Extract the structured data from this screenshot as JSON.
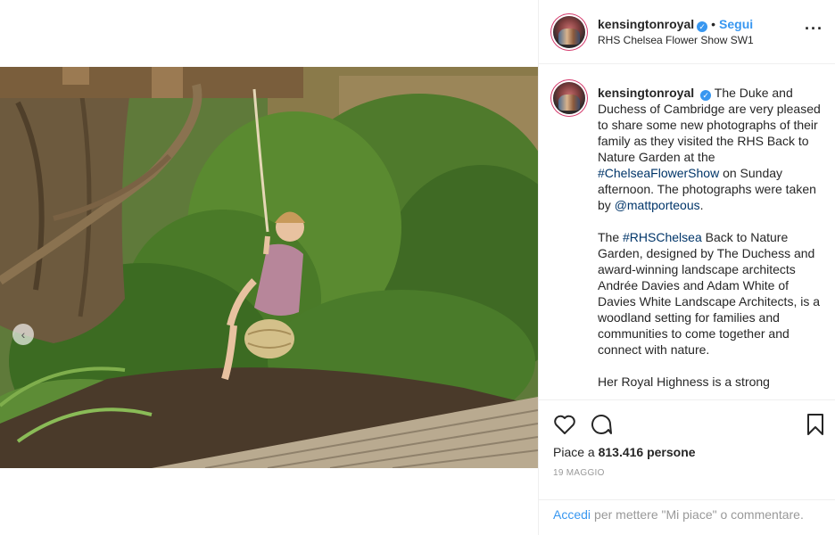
{
  "media": {
    "carousel_prev": "‹"
  },
  "header": {
    "username": "kensingtonroyal",
    "verified_mark": "✓",
    "separator": "•",
    "follow_label": "Segui",
    "location": "RHS Chelsea Flower Show SW1",
    "more_label": "···"
  },
  "caption": {
    "username": "kensingtonroyal",
    "p1_a": "The Duke and Duchess of Cambridge are very pleased to share some new photographs of their family as they visited the RHS Back to Nature Garden at the ",
    "p1_tag": "#ChelseaFlowerShow",
    "p1_b": " on Sunday afternoon. The photographs were taken by ",
    "p1_mention": "@mattporteous",
    "p1_c": ".",
    "p2_a": "The ",
    "p2_tag": "#RHSChelsea",
    "p2_b": " Back to Nature Garden, designed by The Duchess and award-winning landscape architects Andrée Davies and Adam White of Davies White Landscape Architects, is a woodland setting for families and communities to come together and connect with nature.",
    "p3": "Her Royal Highness is a strong"
  },
  "actions": {
    "likes_prefix": "Piace a ",
    "likes_count": "813.416",
    "likes_suffix": " persone",
    "date": "19 MAGGIO"
  },
  "login": {
    "link": "Accedi",
    "text": "per mettere \"Mi piace\" o commentare."
  },
  "colors": {
    "accent_blue": "#3897f0",
    "hashtag": "#003569",
    "text": "#262626",
    "muted": "#999999",
    "border": "#efefef"
  },
  "icons": [
    "heart-icon",
    "comment-icon",
    "bookmark-icon",
    "verified-badge-icon",
    "more-options-icon",
    "chevron-left-icon"
  ]
}
